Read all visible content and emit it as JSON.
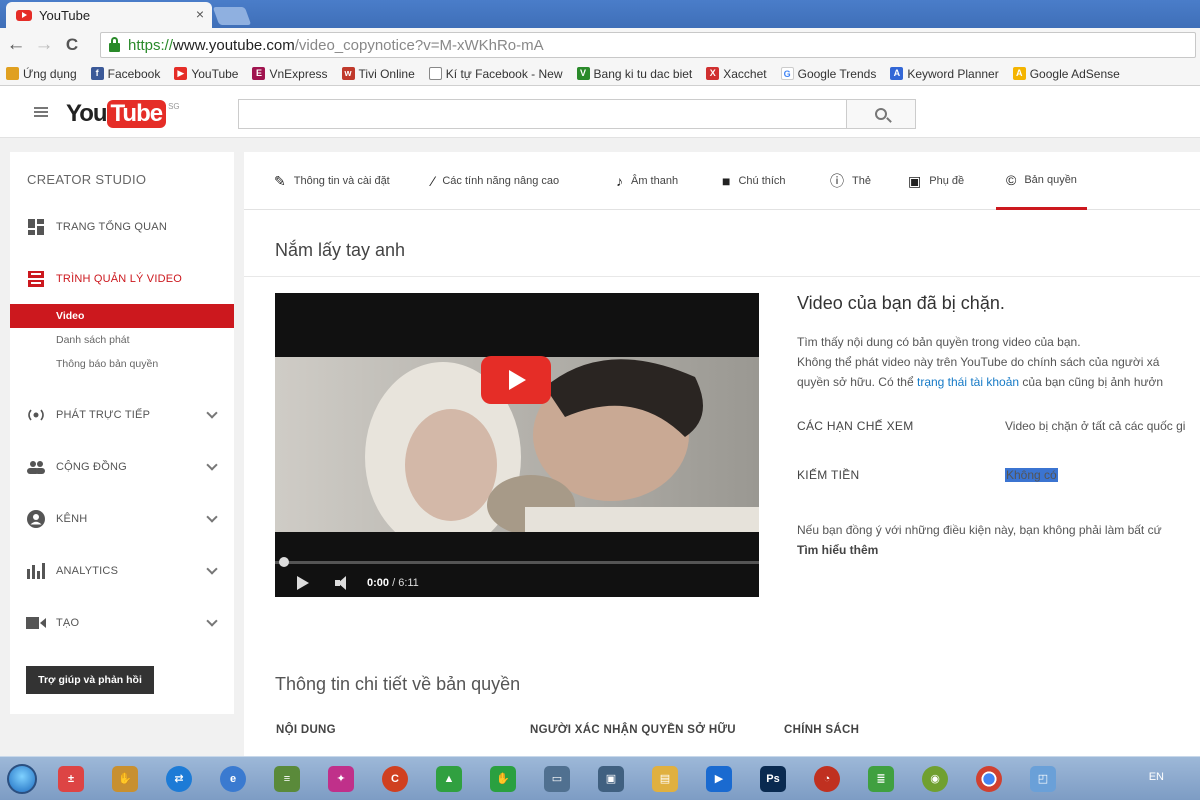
{
  "browser": {
    "tab_title": "YouTube",
    "tab_close": "×",
    "nav_back": "←",
    "nav_forward": "→",
    "nav_reload": "C",
    "url_scheme": "https://",
    "url_host": "www.youtube.com",
    "url_path": "/video_copynotice?v=M-xWKhRo-mA"
  },
  "bookmarks": [
    {
      "label": "Ứng dụng",
      "icon": "apps-grid-icon",
      "color": "#e0a020"
    },
    {
      "label": "Facebook",
      "icon": "facebook-icon",
      "color": "#3b5998"
    },
    {
      "label": "YouTube",
      "icon": "youtube-icon",
      "color": "#e52d27"
    },
    {
      "label": "VnExpress",
      "icon": "vnexpress-icon",
      "color": "#a0144f"
    },
    {
      "label": "Tivi Online",
      "icon": "tv-icon",
      "color": "#c0392b"
    },
    {
      "label": "Kí tự Facebook - New",
      "icon": "page-icon",
      "color": "#888888"
    },
    {
      "label": "Bang ki tu dac biet",
      "icon": "check-icon",
      "color": "#2a8a2a"
    },
    {
      "label": "Xacchet",
      "icon": "xacchet-icon",
      "color": "#d03030"
    },
    {
      "label": "Google Trends",
      "icon": "google-icon",
      "color": "#4285f4"
    },
    {
      "label": "Keyword Planner",
      "icon": "adwords-icon",
      "color": "#3367d6"
    },
    {
      "label": "Google AdSense",
      "icon": "adsense-icon",
      "color": "#f4b400"
    }
  ],
  "header": {
    "logo_you": "You",
    "logo_tube": "Tube",
    "logo_region": "SG",
    "search_placeholder": ""
  },
  "sidebar": {
    "title": "CREATOR STUDIO",
    "items": [
      {
        "label": "TRANG TỔNG QUAN",
        "icon": "dashboard-icon",
        "active": false
      },
      {
        "label": "TRÌNH QUẢN LÝ VIDEO",
        "icon": "video-manager-icon",
        "active": true
      },
      {
        "label": "PHÁT TRỰC TIẾP",
        "icon": "live-icon",
        "active": false
      },
      {
        "label": "CỘNG ĐỒNG",
        "icon": "community-icon",
        "active": false
      },
      {
        "label": "KÊNH",
        "icon": "channel-icon",
        "active": false
      },
      {
        "label": "ANALYTICS",
        "icon": "analytics-icon",
        "active": false
      },
      {
        "label": "TẠO",
        "icon": "create-icon",
        "active": false
      }
    ],
    "subitems": [
      {
        "label": "Video",
        "active": true
      },
      {
        "label": "Danh sách phát",
        "active": false
      },
      {
        "label": "Thông báo bản quyền",
        "active": false
      }
    ],
    "help_button": "Trợ giúp và phản hồi"
  },
  "edit_tabs": [
    {
      "label": "Thông tin và cài đặt",
      "icon": "pencil-icon"
    },
    {
      "label": "Các tính năng nâng cao",
      "icon": "magic-wand-icon"
    },
    {
      "label": "Âm thanh",
      "icon": "music-note-icon"
    },
    {
      "label": "Chú thích",
      "icon": "speech-bubble-icon"
    },
    {
      "label": "Thẻ",
      "icon": "info-icon"
    },
    {
      "label": "Phụ đề",
      "icon": "cc-icon"
    },
    {
      "label": "Bản quyền",
      "icon": "copyright-icon",
      "active": true
    }
  ],
  "video": {
    "title": "Nắm lấy tay anh",
    "current_time": "0:00",
    "duration": "/ 6:11",
    "progress": 0
  },
  "notice": {
    "heading": "Video của bạn đã bị chặn.",
    "line1": "Tìm thấy nội dung có bản quyền trong video của bạn.",
    "line2": "Không thể phát video này trên YouTube do chính sách của người xá",
    "line3_pre": "quyền sở hữu. Có thể ",
    "line3_link": "trạng thái tài khoản",
    "line3_post": " của bạn cũng bị ảnh hưởn",
    "restrictions_label": "CÁC HẠN CHẾ XEM",
    "restrictions_value": "Video bị chặn ở tất cả các quốc gi",
    "monetization_label": "KIẾM TIỀN",
    "monetization_value": "Không có",
    "agree_text": "Nếu bạn đồng ý với những điều kiện này, bạn không phải làm bất cứ",
    "learn_more": "Tìm hiểu thêm"
  },
  "details": {
    "heading": "Thông tin chi tiết về bản quyền",
    "columns": [
      "NỘI DUNG",
      "NGƯỜI XÁC NHẬN QUYỀN SỞ HỮU",
      "CHÍNH SÁCH"
    ]
  },
  "taskbar": {
    "apps": [
      {
        "icon": "start-orb-icon"
      },
      {
        "icon": "calculator-icon",
        "color": "#d44"
      },
      {
        "icon": "hand-cursor-icon",
        "color": "#c89030"
      },
      {
        "icon": "teamviewer-icon",
        "color": "#1d7bd6"
      },
      {
        "icon": "internet-icon",
        "color": "#3a7ad0"
      },
      {
        "icon": "notepad-icon",
        "color": "#5a8a3a"
      },
      {
        "icon": "colors-icon",
        "color": "#c0308a"
      },
      {
        "icon": "ccleaner-icon",
        "color": "#d04020"
      },
      {
        "icon": "chart-app-icon",
        "color": "#30a040"
      },
      {
        "icon": "green-hand-icon",
        "color": "#2aa040"
      },
      {
        "icon": "screen-capture-icon",
        "color": "#507090"
      },
      {
        "icon": "monitor-icon",
        "color": "#406080"
      },
      {
        "icon": "folder-icon",
        "color": "#e0b040"
      },
      {
        "icon": "media-player-icon",
        "color": "#1a6ad0"
      },
      {
        "icon": "photoshop-icon",
        "color": "#0a2a50"
      },
      {
        "icon": "network-icon",
        "color": "#c03020"
      },
      {
        "icon": "stack-icon",
        "color": "#40a040"
      },
      {
        "icon": "coccoc-icon",
        "color": "#70a030"
      },
      {
        "icon": "chrome-icon",
        "color": "#d04030"
      },
      {
        "icon": "window-icon",
        "color": "#6aa0d8"
      }
    ],
    "language": "EN"
  }
}
